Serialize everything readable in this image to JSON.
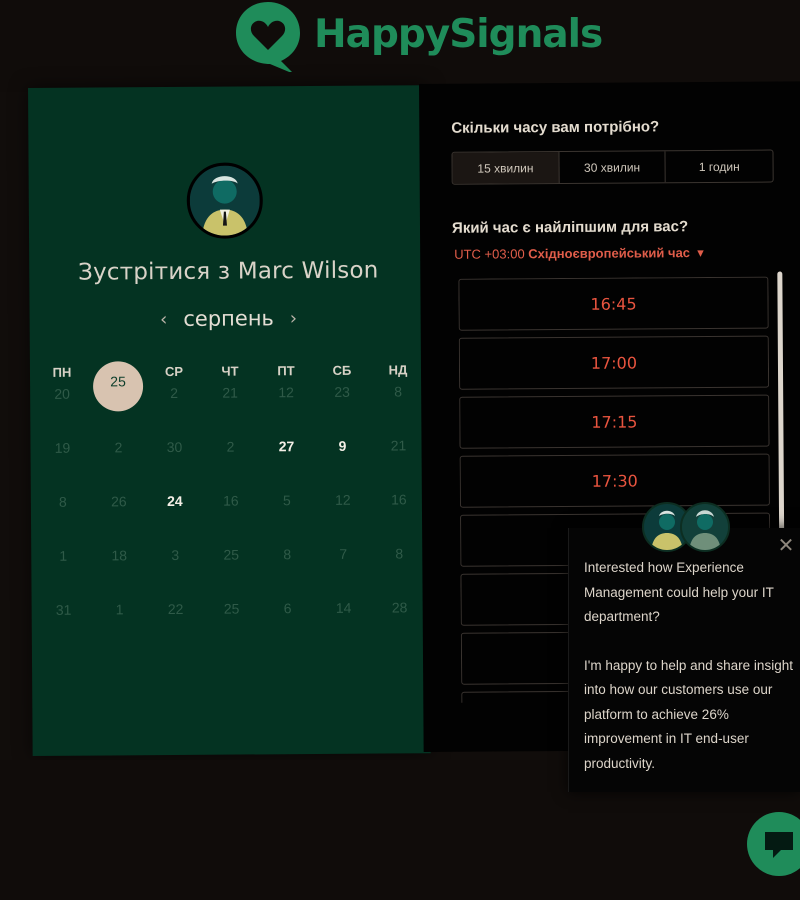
{
  "brand": {
    "name": "HappySignals",
    "color": "#1f8c5a"
  },
  "booking": {
    "title_prefix": "Зустрітися з",
    "host_name": "Marc Wilson",
    "month": "серпень",
    "prev_icon": "chevron-left-icon",
    "next_icon": "chevron-right-icon",
    "weekdays": [
      "ПН",
      "ВТ",
      "СР",
      "ЧТ",
      "ПТ",
      "СБ",
      "НД"
    ],
    "weeks": [
      [
        {
          "d": "20",
          "s": "off"
        },
        {
          "d": "25",
          "s": "selected"
        },
        {
          "d": "2",
          "s": "off"
        },
        {
          "d": "21",
          "s": "off"
        },
        {
          "d": "12",
          "s": "off"
        },
        {
          "d": "23",
          "s": "off"
        },
        {
          "d": "8",
          "s": "off"
        }
      ],
      [
        {
          "d": "19",
          "s": "off"
        },
        {
          "d": "2",
          "s": "off"
        },
        {
          "d": "30",
          "s": "off"
        },
        {
          "d": "2",
          "s": "off"
        },
        {
          "d": "27",
          "s": "active"
        },
        {
          "d": "9",
          "s": "active"
        },
        {
          "d": "21",
          "s": "off"
        }
      ],
      [
        {
          "d": "8",
          "s": "off"
        },
        {
          "d": "26",
          "s": "off"
        },
        {
          "d": "24",
          "s": "active"
        },
        {
          "d": "16",
          "s": "off"
        },
        {
          "d": "5",
          "s": "off"
        },
        {
          "d": "12",
          "s": "off"
        },
        {
          "d": "16",
          "s": "off"
        }
      ],
      [
        {
          "d": "1",
          "s": "off"
        },
        {
          "d": "18",
          "s": "off"
        },
        {
          "d": "3",
          "s": "off"
        },
        {
          "d": "25",
          "s": "off"
        },
        {
          "d": "8",
          "s": "off"
        },
        {
          "d": "7",
          "s": "off"
        },
        {
          "d": "8",
          "s": "off"
        }
      ],
      [
        {
          "d": "31",
          "s": "off"
        },
        {
          "d": "1",
          "s": "off"
        },
        {
          "d": "22",
          "s": "off"
        },
        {
          "d": "25",
          "s": "off"
        },
        {
          "d": "6",
          "s": "off"
        },
        {
          "d": "14",
          "s": "off"
        },
        {
          "d": "28",
          "s": "off"
        }
      ]
    ]
  },
  "scheduler": {
    "duration_question": "Скільки часу вам потрібно?",
    "durations": [
      {
        "label": "15 хвилин",
        "selected": true
      },
      {
        "label": "30 хвилин",
        "selected": false
      },
      {
        "label": "1 годин",
        "selected": false
      }
    ],
    "time_question": "Який час є найліпшим для вас?",
    "tz_offset": "UTC +03:00",
    "tz_name": "Східноєвропейський час",
    "tz_icon": "caret-down-icon",
    "tz_color": "#e05d4a",
    "slots": [
      "16:45",
      "17:00",
      "17:15",
      "17:30",
      "",
      "",
      "",
      ""
    ]
  },
  "chat_popup": {
    "message_1": "Interested how Experience Management could help your IT department?",
    "message_2": "I'm happy to help and share insight into how our customers use our platform to achieve 26% improvement in IT end-user productivity.",
    "close_icon": "close-icon",
    "launcher_icon": "chat-bubble-icon"
  }
}
